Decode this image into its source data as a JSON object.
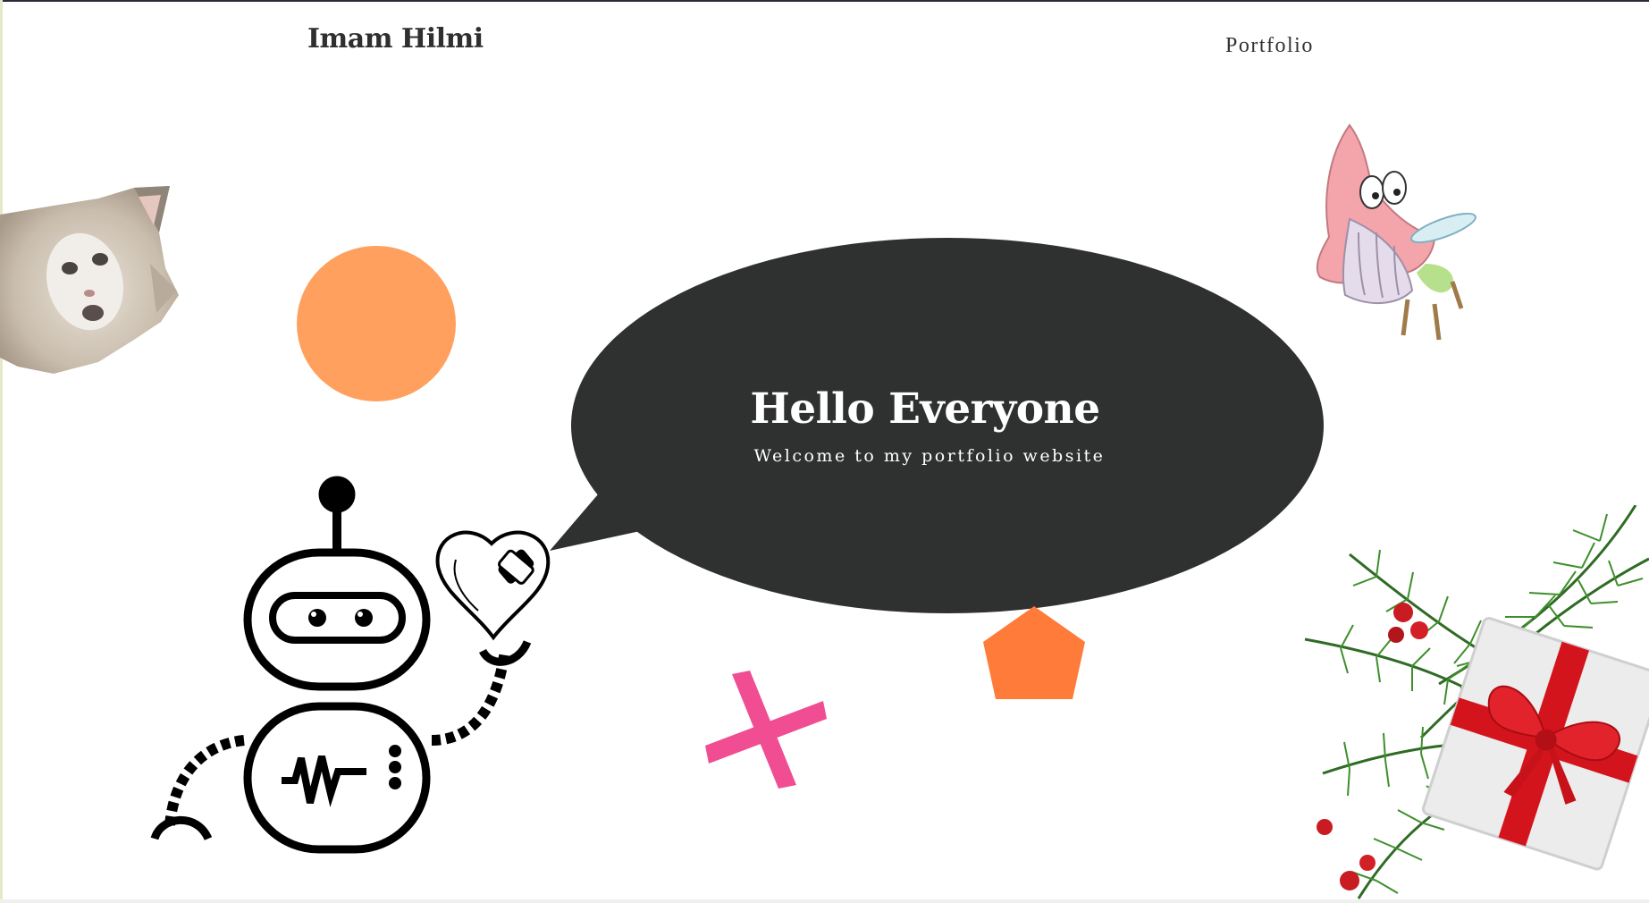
{
  "header": {
    "brand": "Imam Hilmi",
    "nav": [
      {
        "label": "Portfolio"
      }
    ]
  },
  "hero": {
    "title": "Hello Everyone",
    "subtitle": "Welcome to my portfolio website"
  },
  "decorations": {
    "cat_sticker": "cat-sticker-image",
    "patrick_sticker": "patrick-star-sticker-image",
    "robot": "robot-holding-heart-icon",
    "gift": "christmas-gift-branch-image",
    "circle_color": "#ffa05e",
    "pentagon_color": "#ff7b3a",
    "cross_color": "#f04d92",
    "bubble_color": "#2f3030"
  }
}
